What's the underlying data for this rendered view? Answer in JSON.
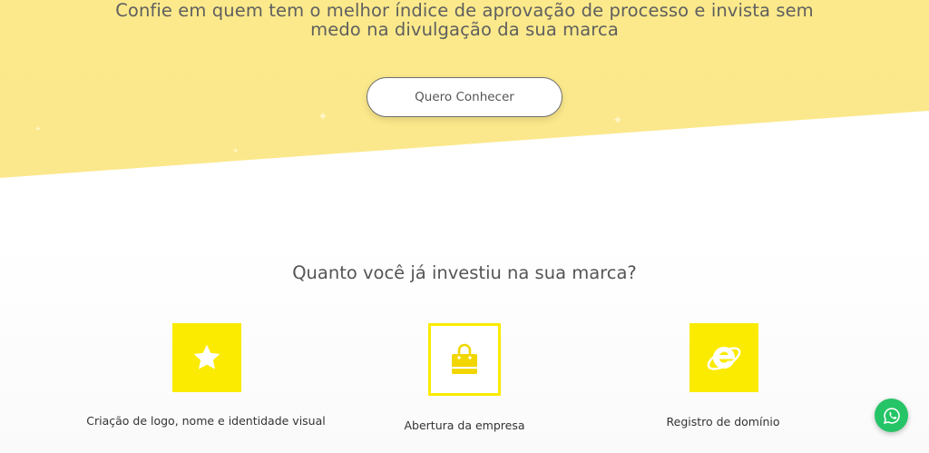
{
  "hero": {
    "headline_line1": "Confie em quem tem o melhor índice de aprovação de processo e invista sem",
    "headline_line2": "medo na divulgação da sua marca",
    "cta_label": "Quero Conhecer",
    "background_color": "#fbe98b"
  },
  "investment_section": {
    "title": "Quanto você já investiu na sua marca?",
    "features": [
      {
        "icon": "star-icon",
        "label": "Criação de logo, nome e identidade visual"
      },
      {
        "icon": "shopping-bag-icon",
        "label": "Abertura da empresa"
      },
      {
        "icon": "internet-explorer-icon",
        "label": "Registro de domínio"
      }
    ],
    "accent_color": "#fbeb00"
  },
  "floating": {
    "whatsapp_icon": "whatsapp-icon",
    "whatsapp_color": "#25c466"
  }
}
